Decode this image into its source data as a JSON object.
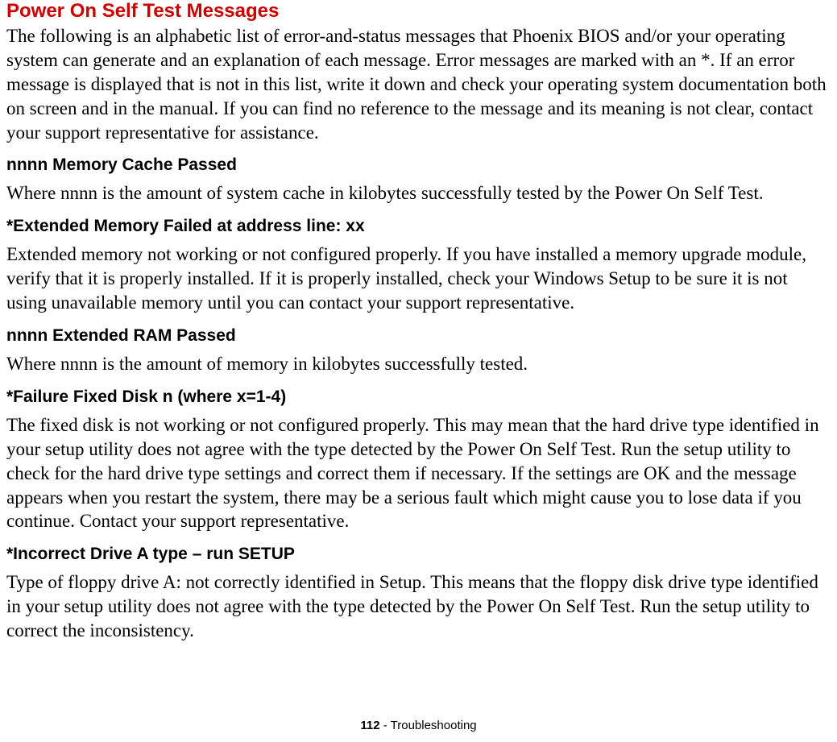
{
  "title": "Power On Self Test Messages",
  "intro": "The following is an alphabetic list of error-and-status messages that Phoenix BIOS and/or your operating system can generate and an explanation of each message. Error messages are marked with an *. If an error message is displayed that is not in this list, write it down and check your operating system documentation both on screen and in the manual. If you can find no reference to the message and its meaning is not clear, contact your support representative for assistance.",
  "sections": [
    {
      "heading": "nnnn Memory Cache Passed",
      "body": "Where nnnn is the amount of system cache in kilobytes successfully tested by the Power On Self Test."
    },
    {
      "heading": "*Extended Memory Failed at address line: xx",
      "body": "Extended memory not working or not configured properly. If you have installed a memory upgrade module, verify that it is properly installed. If it is properly installed, check your Windows Setup to be sure it is not using unavailable memory until you can contact your support representative."
    },
    {
      "heading": "nnnn Extended RAM Passed",
      "body": "Where nnnn is the amount of memory in kilobytes successfully tested."
    },
    {
      "heading": "*Failure Fixed Disk n (where x=1-4)",
      "body": "The fixed disk is not working or not configured properly. This may mean that the hard drive type identified in your setup utility does not agree with the type detected by the Power On Self Test. Run the setup utility to check for the hard drive type settings and correct them if necessary. If the settings are OK and the message appears when you restart the system, there may be a serious fault which might cause you to lose data if you continue. Contact your support representative."
    },
    {
      "heading": "*Incorrect Drive A type – run SETUP",
      "body": "Type of floppy drive A: not correctly identified in Setup. This means that the floppy disk drive type identified in your setup utility does not agree with the type detected by the Power On Self Test. Run the setup utility to correct the inconsistency."
    }
  ],
  "footer": {
    "page": "112",
    "separator": " - ",
    "section": "Troubleshooting"
  }
}
